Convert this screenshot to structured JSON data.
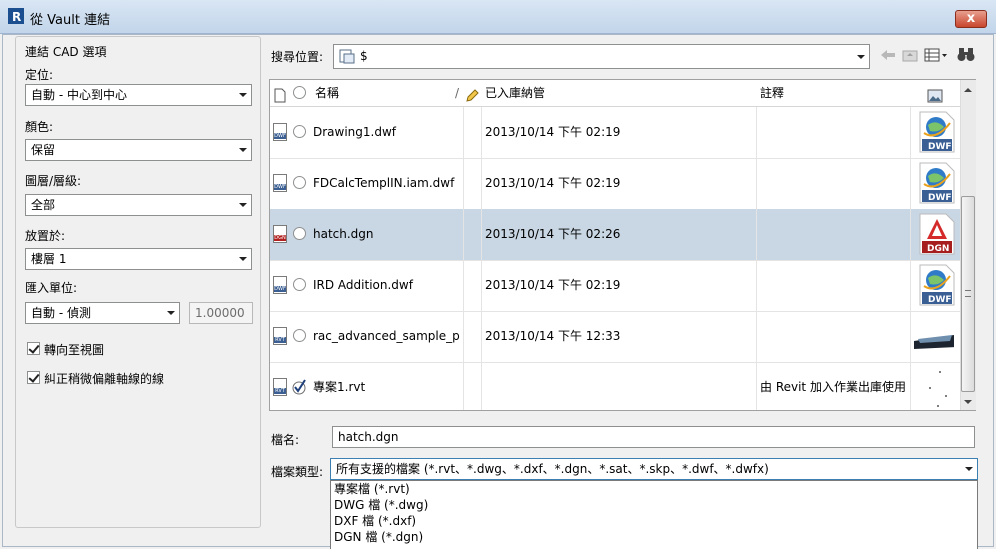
{
  "window": {
    "title": "從 Vault 連結",
    "close_symbol": "x"
  },
  "left_panel": {
    "group_title": "連結 CAD 選項",
    "positioning_label": "定位:",
    "positioning_value": "自動 - 中心到中心",
    "colors_label": "顏色:",
    "colors_value": "保留",
    "layers_label": "圖層/層級:",
    "layers_value": "全部",
    "place_at_label": "放置於:",
    "place_at_value": "樓層 1",
    "import_units_label": "匯入單位:",
    "import_units_value": "自動 - 偵測",
    "scale_value": "1.00000",
    "orient_to_view_label": "轉向至視圖",
    "correct_lines_label": "糾正稍微偏離軸線的線"
  },
  "search": {
    "label": "搜尋位置:",
    "location": "$"
  },
  "table": {
    "headers": {
      "name": "名稱",
      "checked_in": "已入庫納管",
      "comment": "註釋",
      "sort_marker": "/"
    },
    "rows": [
      {
        "icon": "DWF",
        "name": "Drawing1.dwf",
        "date": "2013/10/14 下午 02:19",
        "comment": "",
        "checked": false
      },
      {
        "icon": "DWF",
        "name": "FDCalcTemplIN.iam.dwf",
        "date": "2013/10/14 下午 02:19",
        "comment": "",
        "checked": false
      },
      {
        "icon": "DGN",
        "name": "hatch.dgn",
        "date": "2013/10/14 下午 02:26",
        "comment": "",
        "checked": false,
        "selected": true
      },
      {
        "icon": "DWF",
        "name": "IRD Addition.dwf",
        "date": "2013/10/14 下午 02:19",
        "comment": "",
        "checked": false
      },
      {
        "icon": "RVT",
        "name": "rac_advanced_sample_p...",
        "date": "2013/10/14 下午 12:33",
        "comment": "",
        "checked": false
      },
      {
        "icon": "RVT",
        "name": "專案1.rvt",
        "date": "",
        "comment": "由 Revit 加入作業出庫使用",
        "checked": true
      }
    ]
  },
  "thumb_labels": {
    "dwf": "DWF",
    "dgn": "DGN"
  },
  "filename": {
    "label": "檔名:",
    "value": "hatch.dgn"
  },
  "filetype": {
    "label": "檔案類型:",
    "value": "所有支援的檔案 (*.rvt、*.dwg、*.dxf、*.dgn、*.sat、*.skp、*.dwf、*.dwfx)",
    "options": [
      "專案檔 (*.rvt)",
      "DWG 檔 (*.dwg)",
      "DXF 檔 (*.dxf)",
      "DGN 檔 (*.dgn)"
    ]
  }
}
